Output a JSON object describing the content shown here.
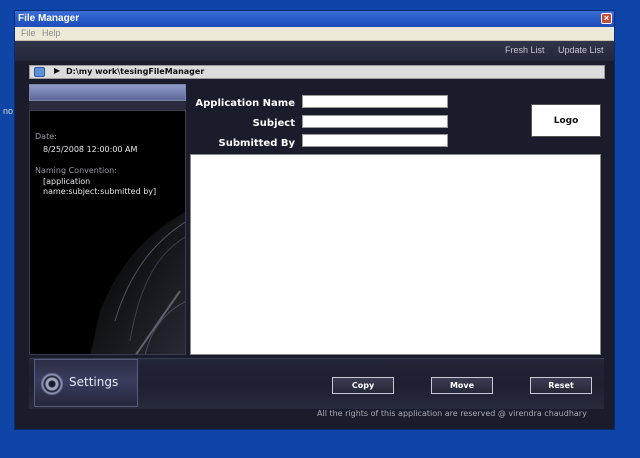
{
  "desktop": {
    "side_text": "no"
  },
  "window": {
    "title": "File Manager",
    "close_symbol": "×"
  },
  "menu": {
    "file": "File",
    "help": "Help"
  },
  "header": {
    "fresh_list": "Fresh List",
    "update_list": "Update List"
  },
  "path": {
    "arrow": "▶",
    "current": "D:\\my work\\tesingFileManager"
  },
  "left_panel": {
    "date_label": "Date:",
    "date_value": "8/25/2008 12:00:00 AM",
    "naming_label": "Naming Convention:",
    "naming_value": "[application name:subject:submitted by]"
  },
  "form": {
    "application_name_label": "Application Name",
    "application_name_value": "",
    "subject_label": "Subject",
    "subject_value": "",
    "submitted_by_label": "Submitted By",
    "submitted_by_value": ""
  },
  "logo": {
    "label": "Logo"
  },
  "buttons": {
    "settings": "Settings",
    "copy": "Copy",
    "move": "Move",
    "reset": "Reset"
  },
  "footer": {
    "text": "All the rights of this application are reserved @ virendra chaudhary"
  },
  "colors": {
    "desktop_bg": "#0f45a6",
    "window_bg": "#1b1c2b",
    "titlebar": "#2557c6",
    "accent_header": "#8e9ac8"
  }
}
